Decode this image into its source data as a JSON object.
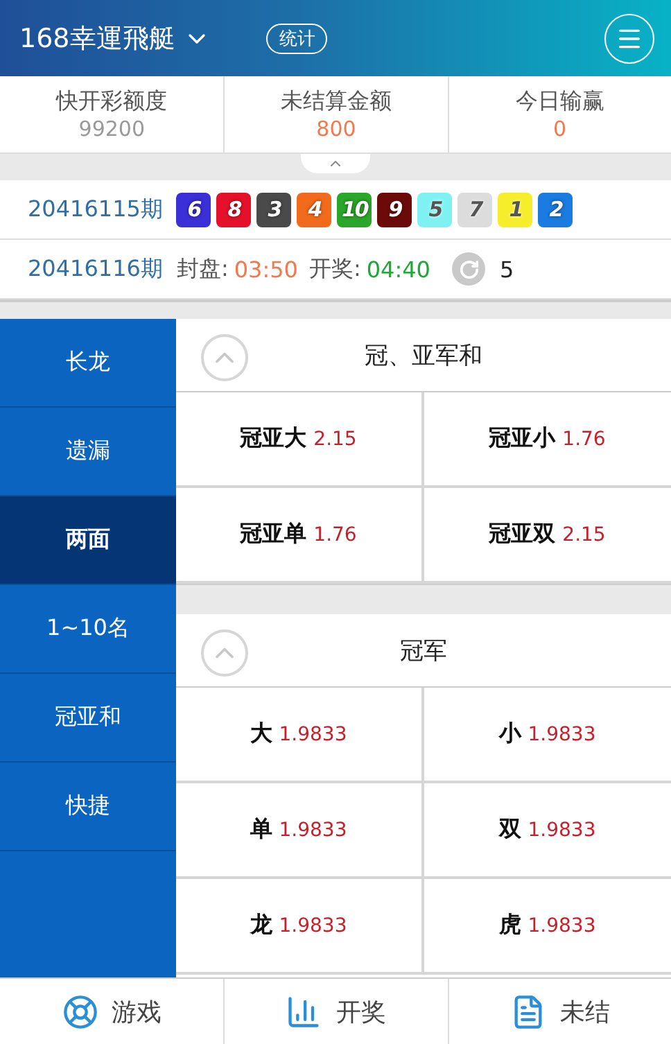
{
  "header": {
    "title": "168幸運飛艇",
    "stats_button": "统计"
  },
  "summary": [
    {
      "label": "快开彩额度",
      "value": "99200",
      "kind": "plain"
    },
    {
      "label": "未结算金额",
      "value": "800",
      "kind": "accent"
    },
    {
      "label": "今日输赢",
      "value": "0",
      "kind": "accent"
    }
  ],
  "last_draw": {
    "period": "20416115期",
    "balls": [
      {
        "number": "6",
        "color": "#3b2fd6"
      },
      {
        "number": "8",
        "color": "#e5112a"
      },
      {
        "number": "3",
        "color": "#4a4a4a"
      },
      {
        "number": "4",
        "color": "#f26b1d"
      },
      {
        "number": "10",
        "color": "#2aa62a"
      },
      {
        "number": "9",
        "color": "#6c0a0a"
      },
      {
        "number": "5",
        "color": "#7ef2f2"
      },
      {
        "number": "7",
        "color": "#dcdcdc"
      },
      {
        "number": "1",
        "color": "#f6ee2a"
      },
      {
        "number": "2",
        "color": "#1a7be0"
      }
    ]
  },
  "next_draw": {
    "period": "20416116期",
    "close_label": "封盘:",
    "close_time": "03:50",
    "draw_label": "开奖:",
    "draw_time": "04:40",
    "refresh_count": "5"
  },
  "sidebar": [
    {
      "label": "长龙",
      "selected": false
    },
    {
      "label": "遗漏",
      "selected": false
    },
    {
      "label": "两面",
      "selected": true
    },
    {
      "label": "1~10名",
      "selected": false
    },
    {
      "label": "冠亚和",
      "selected": false
    },
    {
      "label": "快捷",
      "selected": false
    }
  ],
  "sections": [
    {
      "title": "冠、亚军和",
      "expanded": true,
      "options": [
        {
          "name": "冠亚大",
          "odds": "2.15"
        },
        {
          "name": "冠亚小",
          "odds": "1.76"
        },
        {
          "name": "冠亚单",
          "odds": "1.76"
        },
        {
          "name": "冠亚双",
          "odds": "2.15"
        }
      ]
    },
    {
      "title": "冠军",
      "expanded": true,
      "options": [
        {
          "name": "大",
          "odds": "1.9833"
        },
        {
          "name": "小",
          "odds": "1.9833"
        },
        {
          "name": "单",
          "odds": "1.9833"
        },
        {
          "name": "双",
          "odds": "1.9833"
        },
        {
          "name": "龙",
          "odds": "1.9833"
        },
        {
          "name": "虎",
          "odds": "1.9833"
        }
      ]
    }
  ],
  "bottom_nav": [
    {
      "label": "游戏",
      "kind": "game"
    },
    {
      "label": "开奖",
      "kind": "results"
    },
    {
      "label": "未结",
      "kind": "unsettled"
    }
  ]
}
